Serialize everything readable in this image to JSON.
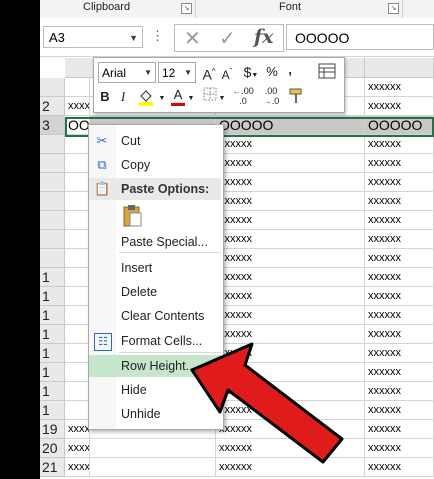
{
  "ribbon": {
    "groups": [
      "Clipboard",
      "Font"
    ]
  },
  "formula_bar": {
    "name_box": "A3",
    "more_dots": "⋮",
    "cancel_symbol": "✕",
    "enter_symbol": "✓",
    "fx_symbol": "fx",
    "content": "OOOOO"
  },
  "mini_toolbar": {
    "font_name": "Arial",
    "font_size": "12",
    "grow_font": "A",
    "shrink_font": "A",
    "currency": "$",
    "percent": "%",
    "comma": ",",
    "bold": "B",
    "italic": "I",
    "font_color_letter": "A",
    "increase_decimal": ".00",
    "decrease_decimal": ".00",
    "fill_color": "#ffff00",
    "font_color": "#e00000"
  },
  "context_menu": {
    "items": [
      {
        "label": "Cut",
        "icon": "scissors-icon"
      },
      {
        "label": "Copy",
        "icon": "copy-icon"
      },
      {
        "label": "Paste Options:",
        "icon": "paste-icon"
      },
      {
        "label": "Paste Special...",
        "icon": ""
      },
      {
        "label": "Insert",
        "icon": ""
      },
      {
        "label": "Delete",
        "icon": ""
      },
      {
        "label": "Clear Contents",
        "icon": ""
      },
      {
        "label": "Format Cells...",
        "icon": "format-cells-icon"
      },
      {
        "label": "Row Height...",
        "icon": ""
      },
      {
        "label": "Hide",
        "icon": ""
      },
      {
        "label": "Unhide",
        "icon": ""
      }
    ],
    "highlighted": "Row Height..."
  },
  "grid": {
    "rows": [
      {
        "num": "",
        "cells": [
          "",
          "",
          "",
          "xxxxxx"
        ]
      },
      {
        "num": "2",
        "cells": [
          "xxxxxx",
          "",
          "",
          "xxxxxx"
        ]
      },
      {
        "num": "3",
        "cells": [
          "OOOOO",
          "",
          "OOOOO",
          "OOOOO"
        ]
      },
      {
        "num": "",
        "cells": [
          "",
          "",
          "xxxxxx",
          "xxxxxx"
        ]
      },
      {
        "num": "",
        "cells": [
          "",
          "",
          "xxxxxx",
          "xxxxxx"
        ]
      },
      {
        "num": "",
        "cells": [
          "",
          "",
          "xxxxxx",
          "xxxxxx"
        ]
      },
      {
        "num": "",
        "cells": [
          "",
          "",
          "xxxxxx",
          "xxxxxx"
        ]
      },
      {
        "num": "",
        "cells": [
          "",
          "",
          "xxxxxx",
          "xxxxxx"
        ]
      },
      {
        "num": "",
        "cells": [
          "",
          "",
          "xxxxxx",
          "xxxxxx"
        ]
      },
      {
        "num": "",
        "cells": [
          "",
          "",
          "xxxxxx",
          "xxxxxx"
        ]
      },
      {
        "num": "1",
        "cells": [
          "",
          "",
          "xxxxxx",
          "xxxxxx"
        ]
      },
      {
        "num": "1",
        "cells": [
          "",
          "",
          "xxxxxx",
          "xxxxxx"
        ]
      },
      {
        "num": "1",
        "cells": [
          "",
          "",
          "xxxxxx",
          "xxxxxx"
        ]
      },
      {
        "num": "1",
        "cells": [
          "",
          "",
          "xxxxxx",
          "xxxxxx"
        ]
      },
      {
        "num": "1",
        "cells": [
          "",
          "",
          "xxxxxx",
          "xxxxxx"
        ]
      },
      {
        "num": "1",
        "cells": [
          "",
          "",
          "xxxxxx",
          "xxxxxx"
        ]
      },
      {
        "num": "1",
        "cells": [
          "",
          "",
          "xxxxxx",
          "xxxxxx"
        ]
      },
      {
        "num": "1",
        "cells": [
          "",
          "",
          "xxxxxx",
          "xxxxxx"
        ]
      },
      {
        "num": "19",
        "cells": [
          "xxxxxx",
          "",
          "xxxxxx",
          "xxxxxx"
        ]
      },
      {
        "num": "20",
        "cells": [
          "xxxxxx",
          "",
          "xxxxxx",
          "xxxxxx"
        ]
      },
      {
        "num": "21",
        "cells": [
          "xxxxxx",
          "",
          "xxxxxx",
          "xxxxxx"
        ]
      }
    ]
  },
  "colors": {
    "selection_border": "#217346",
    "menu_highlight": "#c6e6cb",
    "arrow": "#e01b1b"
  }
}
